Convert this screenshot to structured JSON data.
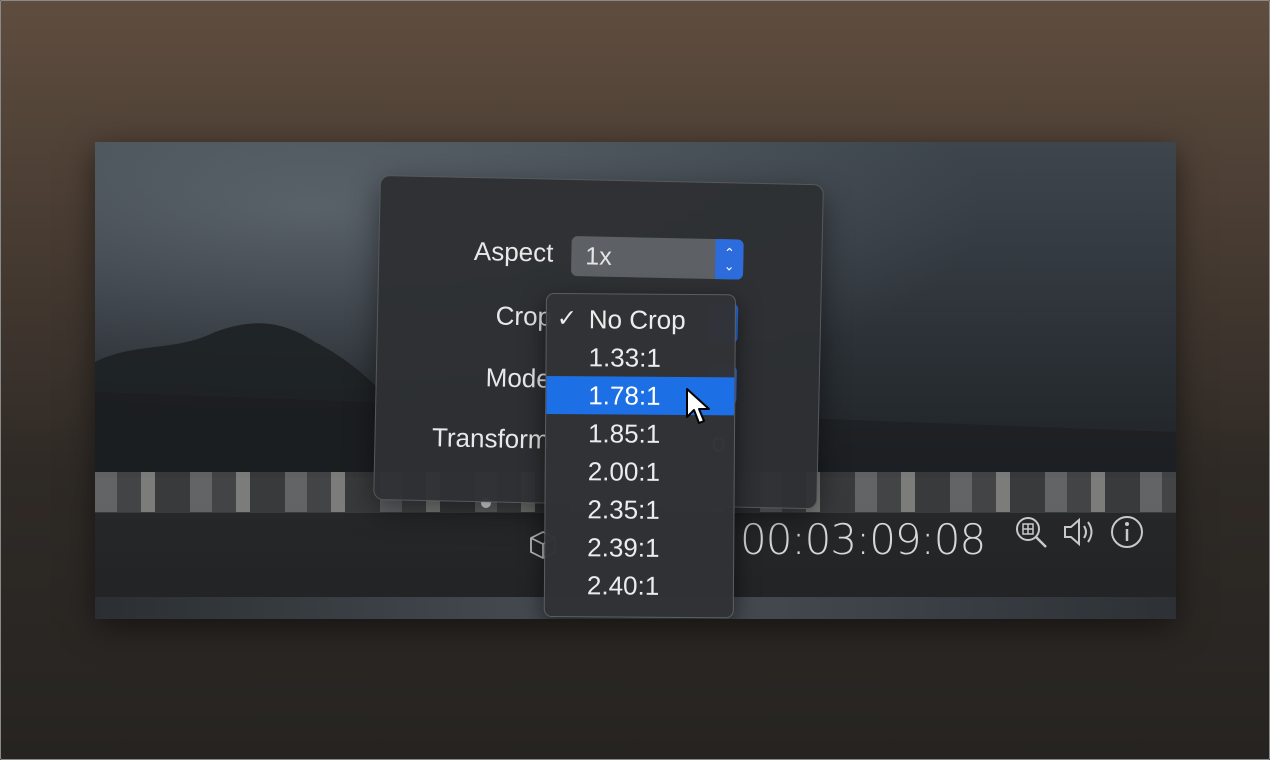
{
  "settings": {
    "aspect_label": "Aspect",
    "aspect_value": "1x",
    "crop_label": "Crop",
    "mode_label": "Mode",
    "transform_label": "Transform",
    "hidden_value_fragment": "o"
  },
  "crop_menu": {
    "items": [
      {
        "label": "No Crop",
        "checked": true
      },
      {
        "label": "1.33:1"
      },
      {
        "label": "1.78:1",
        "highlighted": true
      },
      {
        "label": "1.85:1"
      },
      {
        "label": "2.00:1"
      },
      {
        "label": "2.35:1"
      },
      {
        "label": "2.39:1"
      },
      {
        "label": "2.40:1"
      }
    ],
    "check_glyph": "✓"
  },
  "player": {
    "timecode": "00:03:09:08",
    "icons": [
      "cube-icon",
      "zoom-icon",
      "volume-icon",
      "info-icon"
    ]
  },
  "colors": {
    "accent": "#1d6fe6",
    "popup_arrow": "#2c6cdc"
  }
}
